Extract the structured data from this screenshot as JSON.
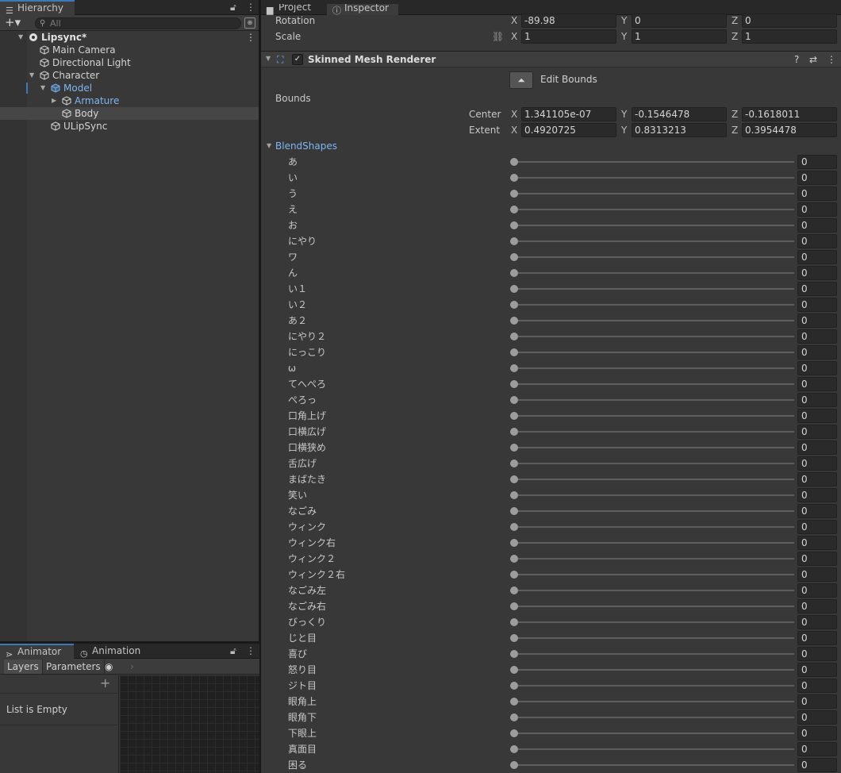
{
  "hierarchy": {
    "tab_label": "Hierarchy",
    "search_placeholder": "All",
    "rows": [
      {
        "label": "Lipsync*",
        "depth": 0,
        "expanded": true,
        "icon": "unity-scene-icon",
        "style": "bold"
      },
      {
        "label": "Main Camera",
        "depth": 1,
        "icon": "gameobject-cube-icon"
      },
      {
        "label": "Directional Light",
        "depth": 1,
        "icon": "gameobject-cube-icon"
      },
      {
        "label": "Character",
        "depth": 1,
        "expanded": true,
        "icon": "gameobject-cube-icon"
      },
      {
        "label": "Model",
        "depth": 2,
        "expanded": true,
        "icon": "prefab-cube-icon",
        "style": "blue"
      },
      {
        "label": "Armature",
        "depth": 3,
        "expanded": false,
        "icon": "gameobject-cube-icon",
        "style": "blue"
      },
      {
        "label": "Body",
        "depth": 3,
        "icon": "gameobject-cube-icon",
        "selected": true
      },
      {
        "label": "ULipSync",
        "depth": 2,
        "icon": "gameobject-cube-icon"
      }
    ]
  },
  "animator": {
    "tabs": [
      "Animator",
      "Animation"
    ],
    "sub_tabs": [
      "Layers",
      "Parameters"
    ],
    "list_empty": "List is Empty"
  },
  "inspector": {
    "tabs": [
      "Project",
      "Inspector"
    ],
    "rotation": {
      "label": "Rotation",
      "x": "-89.98",
      "y": "0",
      "z": "0"
    },
    "scale": {
      "label": "Scale",
      "x": "1",
      "y": "1",
      "z": "1"
    },
    "component": {
      "title": "Skinned Mesh Renderer",
      "enabled": true
    },
    "edit_bounds_label": "Edit Bounds",
    "bounds": {
      "label": "Bounds",
      "center": {
        "label": "Center",
        "x": "1.341105e-07",
        "y": "-0.1546478",
        "z": "-0.1618011"
      },
      "extent": {
        "label": "Extent",
        "x": "0.4920725",
        "y": "0.8313213",
        "z": "0.3954478"
      }
    },
    "blendshapes_label": "BlendShapes",
    "blendshapes": [
      {
        "name": "あ",
        "value": 0
      },
      {
        "name": "い",
        "value": 0
      },
      {
        "name": "う",
        "value": 0
      },
      {
        "name": "え",
        "value": 0
      },
      {
        "name": "お",
        "value": 0
      },
      {
        "name": "にやり",
        "value": 0
      },
      {
        "name": "ワ",
        "value": 0
      },
      {
        "name": "ん",
        "value": 0
      },
      {
        "name": "い１",
        "value": 0
      },
      {
        "name": "い２",
        "value": 0
      },
      {
        "name": "あ２",
        "value": 0
      },
      {
        "name": "にやり２",
        "value": 0
      },
      {
        "name": "にっこり",
        "value": 0
      },
      {
        "name": "ω",
        "value": 0
      },
      {
        "name": "てへぺろ",
        "value": 0
      },
      {
        "name": "ぺろっ",
        "value": 0
      },
      {
        "name": "口角上げ",
        "value": 0
      },
      {
        "name": "口横広げ",
        "value": 0
      },
      {
        "name": "口横狭め",
        "value": 0
      },
      {
        "name": "舌広げ",
        "value": 0
      },
      {
        "name": "まばたき",
        "value": 0
      },
      {
        "name": "笑い",
        "value": 0
      },
      {
        "name": "なごみ",
        "value": 0
      },
      {
        "name": "ウィンク",
        "value": 0
      },
      {
        "name": "ウィンク右",
        "value": 0
      },
      {
        "name": "ウィンク２",
        "value": 0
      },
      {
        "name": "ウィンク２右",
        "value": 0
      },
      {
        "name": "なごみ左",
        "value": 0
      },
      {
        "name": "なごみ右",
        "value": 0
      },
      {
        "name": "びっくり",
        "value": 0
      },
      {
        "name": "じと目",
        "value": 0
      },
      {
        "name": "喜び",
        "value": 0
      },
      {
        "name": "怒り目",
        "value": 0
      },
      {
        "name": "ジト目",
        "value": 0
      },
      {
        "name": "眼角上",
        "value": 0
      },
      {
        "name": "眼角下",
        "value": 0
      },
      {
        "name": "下眼上",
        "value": 0
      },
      {
        "name": "真面目",
        "value": 0
      },
      {
        "name": "困る",
        "value": 0
      }
    ]
  }
}
